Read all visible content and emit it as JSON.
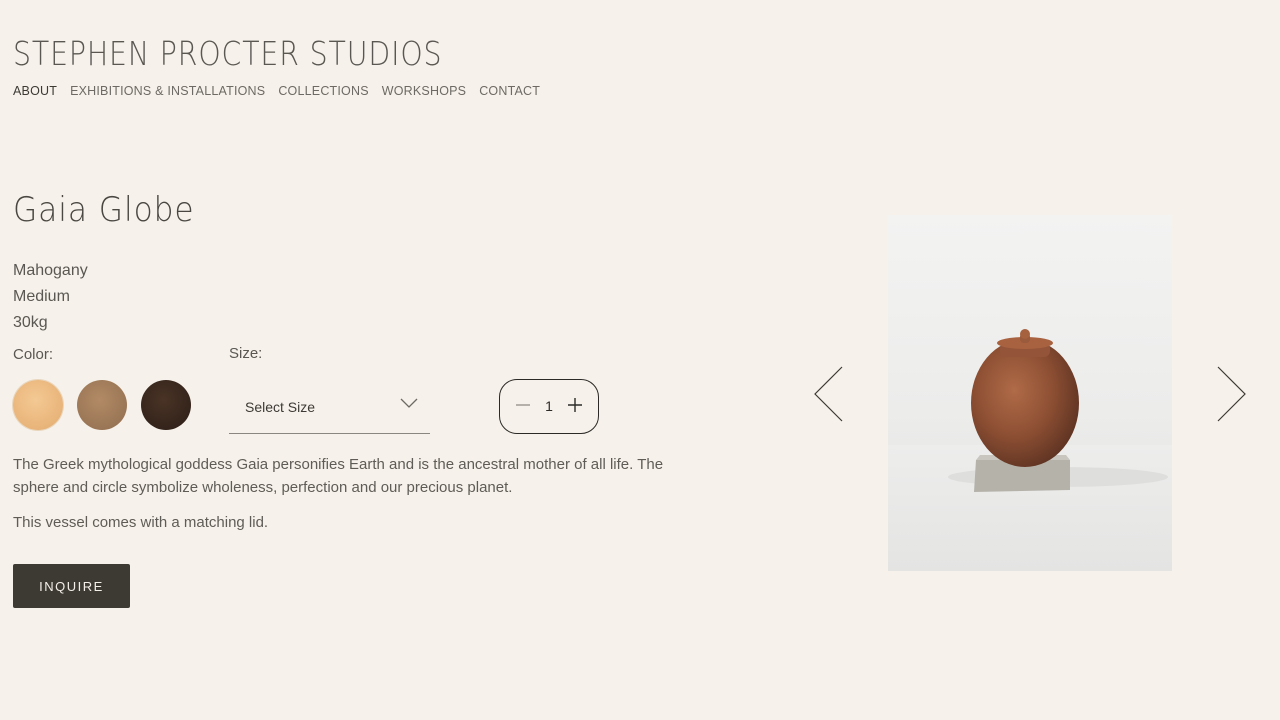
{
  "header": {
    "brand": "STEPHEN PROCTER STUDIOS",
    "nav": [
      {
        "label": "ABOUT",
        "active": true
      },
      {
        "label": "EXHIBITIONS & INSTALLATIONS",
        "active": false
      },
      {
        "label": "COLLECTIONS",
        "active": false
      },
      {
        "label": "WORKSHOPS",
        "active": false
      },
      {
        "label": "CONTACT",
        "active": false
      }
    ]
  },
  "product": {
    "title": "Gaia Globe",
    "specs": [
      "Mahogany",
      "Medium",
      "30kg"
    ],
    "color_label": "Color:",
    "colors": [
      "#e8b47a",
      "#9a7656",
      "#34241b"
    ],
    "size_label": "Size:",
    "size_value": "Select Size",
    "quantity": "1",
    "description": [
      "The Greek mythological goddess Gaia personifies Earth and is the ancestral mother of all life. The sphere and circle symbolize wholeness, perfection and our precious planet.",
      "This vessel comes with a matching lid."
    ],
    "inquire_label": "INQUIRE"
  },
  "gallery": {
    "image": "wooden-globe-vessel-photo",
    "prev_icon": "chevron-left-icon",
    "next_icon": "chevron-right-icon"
  }
}
